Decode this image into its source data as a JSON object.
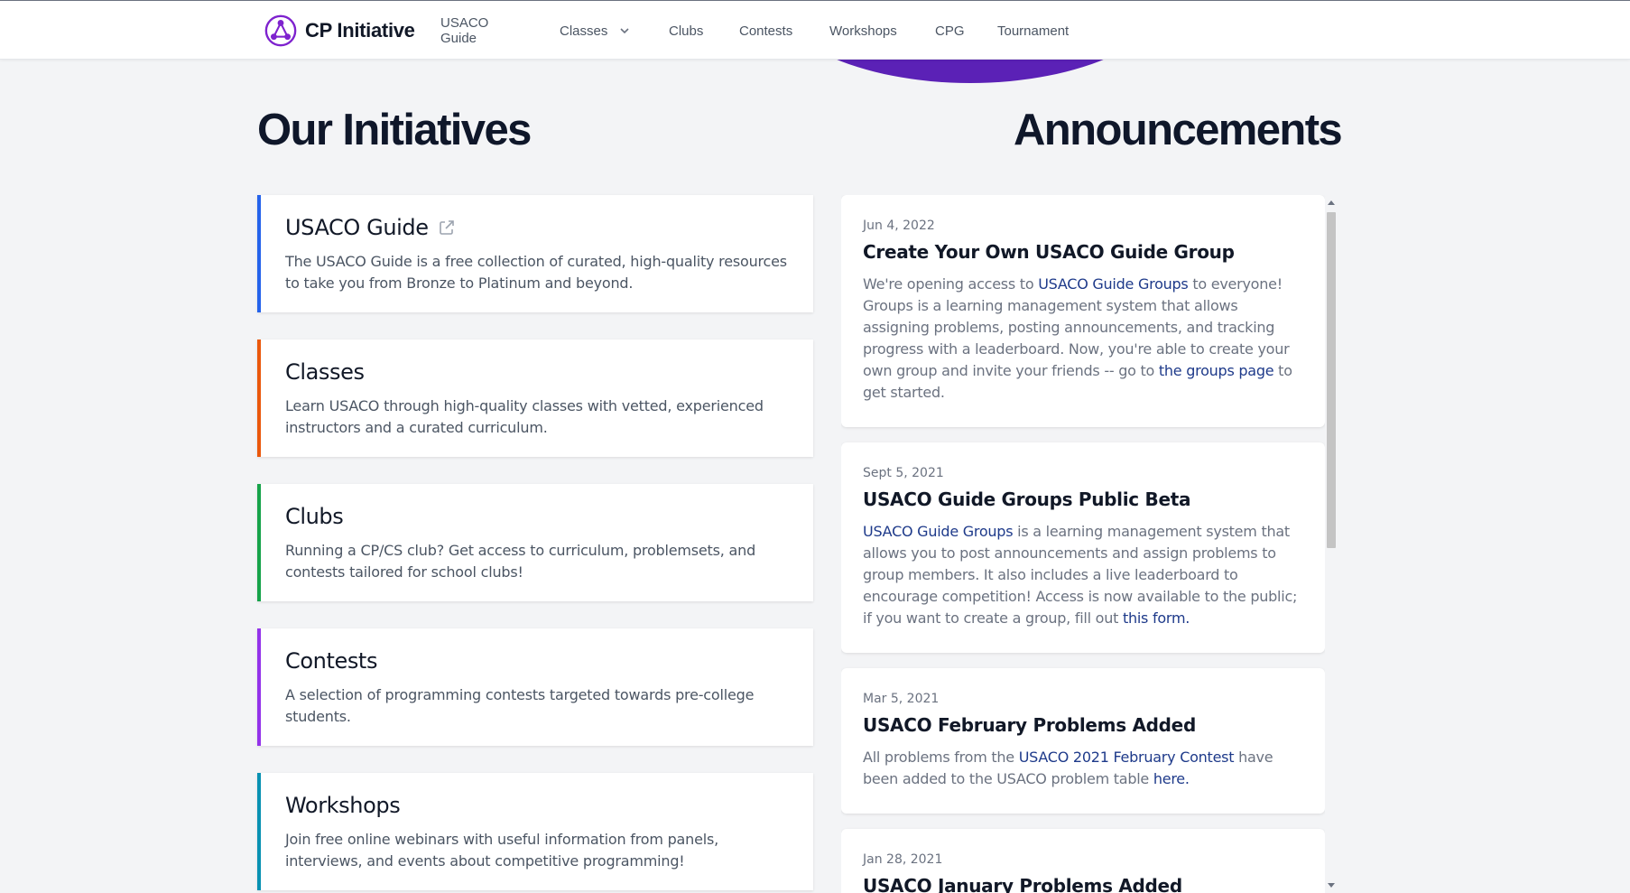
{
  "header": {
    "brand": "CP Initiative",
    "nav": [
      {
        "label": "USACO Guide"
      },
      {
        "label": "Classes",
        "has_dropdown": true
      },
      {
        "label": "Clubs"
      },
      {
        "label": "Contests"
      },
      {
        "label": "Workshops"
      },
      {
        "label": "CPG"
      },
      {
        "label": "Tournament"
      }
    ]
  },
  "initiatives": {
    "heading": "Our Initiatives",
    "items": [
      {
        "title": "USACO Guide",
        "external": true,
        "accent": "#2563eb",
        "description": "The USACO Guide is a free collection of curated, high-quality resources to take you from Bronze to Platinum and beyond."
      },
      {
        "title": "Classes",
        "accent": "#ea580c",
        "description": "Learn USACO through high-quality classes with vetted, experienced instructors and a curated curriculum."
      },
      {
        "title": "Clubs",
        "accent": "#16a34a",
        "description": "Running a CP/CS club? Get access to curriculum, problemsets, and contests tailored for school clubs!"
      },
      {
        "title": "Contests",
        "accent": "#9333ea",
        "description": "A selection of programming contests targeted towards pre-college students."
      },
      {
        "title": "Workshops",
        "accent": "#0891b2",
        "description": "Join free online webinars with useful information from panels, interviews, and events about competitive programming!"
      }
    ]
  },
  "announcements": {
    "heading": "Announcements",
    "items": [
      {
        "date": "Jun 4, 2022",
        "title": "Create Your Own USACO Guide Group",
        "body": [
          {
            "t": "We're opening access to "
          },
          {
            "t": "USACO Guide Groups",
            "link": true
          },
          {
            "t": " to everyone! Groups is a learning management system that allows assigning problems, posting announcements, and tracking progress with a leaderboard. Now, you're able to create your own group and invite your friends -- go to "
          },
          {
            "t": "the groups page",
            "link": true
          },
          {
            "t": " to get started."
          }
        ]
      },
      {
        "date": "Sept 5, 2021",
        "title": "USACO Guide Groups Public Beta",
        "body": [
          {
            "t": "USACO Guide Groups",
            "link": true
          },
          {
            "t": " is a learning management system that allows you to post announcements and assign problems to group members. It also includes a live leaderboard to encourage competition! Access is now available to the public; if you want to create a group, fill out "
          },
          {
            "t": "this form.",
            "link": true
          }
        ]
      },
      {
        "date": "Mar 5, 2021",
        "title": "USACO February Problems Added",
        "body": [
          {
            "t": "All problems from the "
          },
          {
            "t": "USACO 2021 February Contest",
            "link": true
          },
          {
            "t": " have been added to the USACO problem table "
          },
          {
            "t": "here.",
            "link": true
          }
        ]
      },
      {
        "date": "Jan 28, 2021",
        "title": "USACO January Problems Added",
        "body": []
      }
    ]
  },
  "colors": {
    "brand_purple": "#5b21b6",
    "link": "#1e3a8a"
  }
}
